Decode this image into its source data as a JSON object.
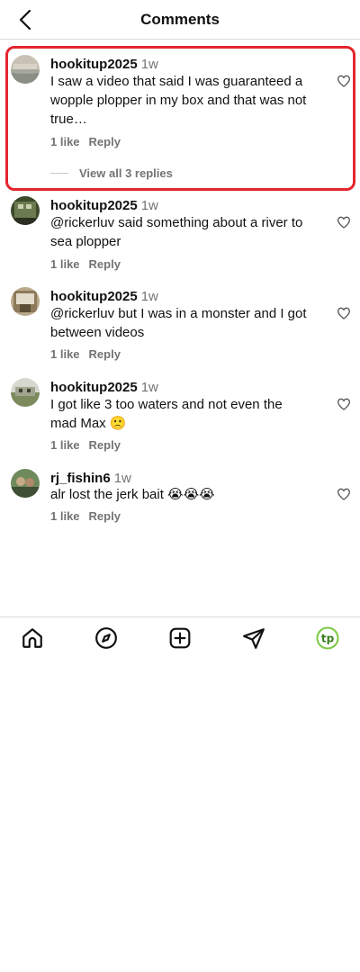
{
  "header": {
    "title": "Comments",
    "back_icon": "chevron-left-icon"
  },
  "comments": [
    {
      "username": "hookitup2025",
      "time": "1w",
      "text": "I saw a video that said I was guaranteed a wopple plopper in my box and that was not true…",
      "likes": "1 like",
      "reply": "Reply",
      "view_replies": "View all 3 replies"
    },
    {
      "username": "hookitup2025",
      "time": "1w",
      "text": "@rickerluv said something about a river to sea plopper",
      "likes": "1 like",
      "reply": "Reply"
    },
    {
      "username": "hookitup2025",
      "time": "1w",
      "text": "@rickerluv but I was in a monster and I got between videos",
      "likes": "1 like",
      "reply": "Reply"
    },
    {
      "username": "hookitup2025",
      "time": "1w",
      "text": "I got like 3 too waters and not even the mad Max 🙁",
      "likes": "1 like",
      "reply": "Reply"
    },
    {
      "username": "rj_fishin6",
      "time": "1w",
      "text": "alr lost the jerk bait 😭😭😭",
      "likes": "1 like",
      "reply": "Reply"
    }
  ],
  "nav": {
    "items": [
      "home-icon",
      "explore-compass-icon",
      "create-plus-icon",
      "send-paper-plane-icon",
      "profile-tp-icon"
    ],
    "profile_text": "tp"
  },
  "colors": {
    "highlight": "#e4262f",
    "muted": "#737373",
    "profile_accent": "#7ac943"
  }
}
